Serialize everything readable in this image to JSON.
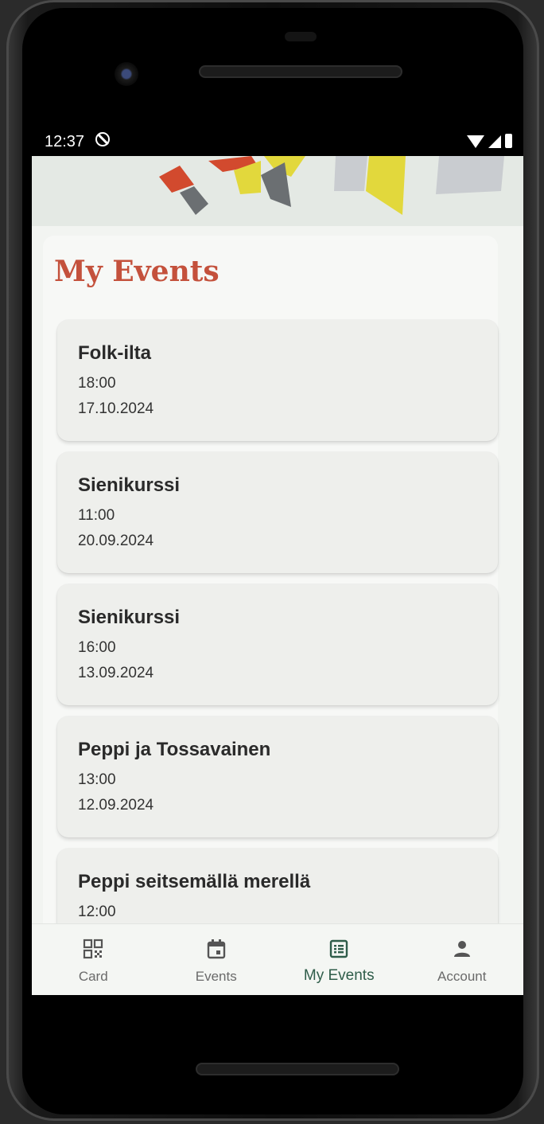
{
  "status_bar": {
    "time": "12:37",
    "icons": [
      "do-not-disturb-icon",
      "wifi-icon",
      "signal-icon",
      "battery-icon"
    ]
  },
  "page": {
    "title": "My Events"
  },
  "events": [
    {
      "title": "Folk-ilta",
      "time": "18:00",
      "date": "17.10.2024"
    },
    {
      "title": "Sienikurssi",
      "time": "11:00",
      "date": "20.09.2024"
    },
    {
      "title": "Sienikurssi",
      "time": "16:00",
      "date": "13.09.2024"
    },
    {
      "title": "Peppi ja Tossavainen",
      "time": "13:00",
      "date": "12.09.2024"
    },
    {
      "title": "Peppi seitsemällä merellä",
      "time": "12:00",
      "date": ""
    }
  ],
  "bottom_nav": {
    "items": [
      {
        "label": "Card",
        "icon": "qr-code-icon"
      },
      {
        "label": "Events",
        "icon": "calendar-icon"
      },
      {
        "label": "My Events",
        "icon": "list-icon",
        "active": true
      },
      {
        "label": "Account",
        "icon": "person-icon"
      }
    ]
  },
  "colors": {
    "accent_title": "#c4513c",
    "active_nav": "#2f5d4a",
    "banner_red": "#d24a2e",
    "banner_yellow": "#e2d83c",
    "banner_gray": "#6b6f72",
    "banner_light": "#c9ccd0"
  }
}
